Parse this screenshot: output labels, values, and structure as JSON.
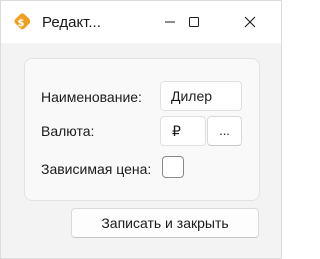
{
  "window": {
    "title": "Редакт..."
  },
  "form": {
    "name_label": "Наименование:",
    "name_value": "Дилер",
    "currency_label": "Валюта:",
    "currency_value": "₽",
    "currency_select_label": "...",
    "dependent_price_label": "Зависимая цена:",
    "dependent_price_checked": false
  },
  "footer": {
    "save_close_label": "Записать и закрыть"
  },
  "icons": {
    "app": "app-tag-icon",
    "minimize": "minimize-icon",
    "maximize": "maximize-icon",
    "close": "close-icon"
  },
  "colors": {
    "app_icon": "#f0a020",
    "window_background": "#f3f3f3",
    "titlebar": "#ffffff"
  }
}
